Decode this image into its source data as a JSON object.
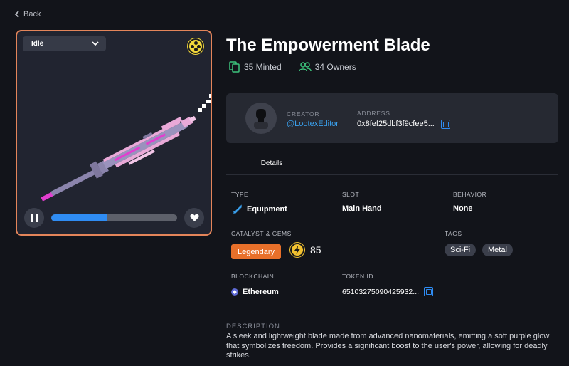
{
  "nav": {
    "back_label": "Back"
  },
  "viewer": {
    "animation": "Idle",
    "progress": 0.44,
    "colors": {
      "border": "#e4855a",
      "progress": "#2f8cf3",
      "blade_pink": "#e9a9d8",
      "blade_grey": "#8b84ac",
      "blade_magenta": "#e23ecf"
    }
  },
  "item": {
    "title": "The Empowerment Blade",
    "minted": "35 Minted",
    "owners": "34 Owners"
  },
  "creator": {
    "creator_label": "CREATOR",
    "creator_name": "@LootexEditor",
    "address_label": "ADDRESS",
    "address_value": "0x8fef25dbf3f9cfee5..."
  },
  "tabs": {
    "details": "Details"
  },
  "details": {
    "type_label": "TYPE",
    "type_value": "Equipment",
    "slot_label": "SLOT",
    "slot_value": "Main Hand",
    "behavior_label": "BEHAVIOR",
    "behavior_value": "None",
    "catalyst_label": "CATALYST & GEMS",
    "rarity": "Legendary",
    "gems": "85",
    "tags_label": "TAGS",
    "tags": [
      "Sci-Fi",
      "Metal"
    ],
    "blockchain_label": "BLOCKCHAIN",
    "blockchain_value": "Ethereum",
    "token_label": "TOKEN ID",
    "token_value": "65103275090425932..."
  },
  "description": {
    "label": "DESCRIPTION",
    "text": "A sleek and lightweight blade made from advanced nanomaterials, emitting a soft purple glow that symbolizes freedom. Provides a significant boost to the user's power, allowing for deadly strikes."
  }
}
